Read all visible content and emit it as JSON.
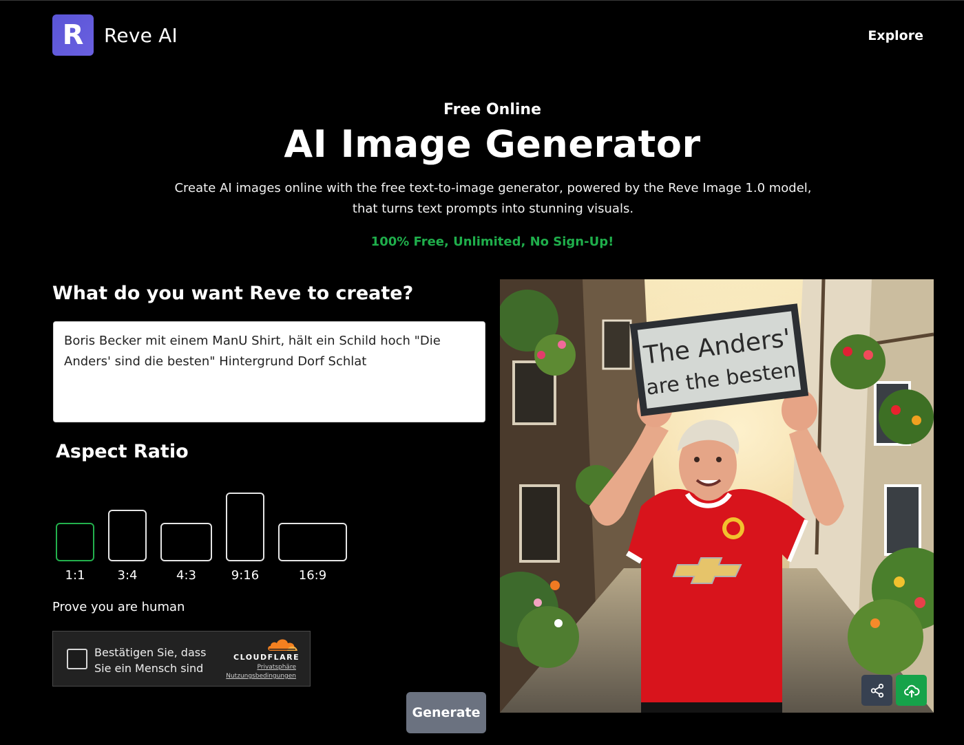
{
  "header": {
    "logo_letter": "R",
    "brand_name": "Reve AI",
    "nav_explore": "Explore"
  },
  "hero": {
    "kicker": "Free Online",
    "title": "AI Image Generator",
    "description": "Create AI images online with the free text-to-image generator, powered by the Reve Image 1.0 model, that turns text prompts into stunning visuals.",
    "free_note": "100% Free, Unlimited, No Sign-Up!"
  },
  "form": {
    "prompt_heading": "What do you want Reve to create?",
    "prompt_value": "Boris Becker mit einem ManU Shirt, hält ein Schild hoch \"Die Anders' sind die besten\" Hintergrund Dorf Schlat",
    "aspect_heading": "Aspect Ratio",
    "aspect_ratios": [
      "1:1",
      "3:4",
      "4:3",
      "9:16",
      "16:9"
    ],
    "selected_ratio": "1:1",
    "human_label": "Prove you are human",
    "generate_label": "Generate"
  },
  "captcha": {
    "text": "Bestätigen Sie, dass Sie ein Mensch sind",
    "brand": "CLOUDFLARE",
    "privacy_link": "Privatsphäre",
    "terms_link": "Nutzungsbedingungen"
  },
  "result": {
    "sign_line1": "The Anders'",
    "sign_line2": "are the besten",
    "share_icon": "share-icon",
    "download_icon": "cloud-download-icon",
    "colors": {
      "share_bg": "#374151",
      "download_bg": "#16a34a",
      "jersey": "#d8141c"
    }
  },
  "theme": {
    "background": "#000000",
    "accent_green": "#1fae4b",
    "logo_purple": "#5a55d6",
    "button_gray": "#6b7280"
  }
}
